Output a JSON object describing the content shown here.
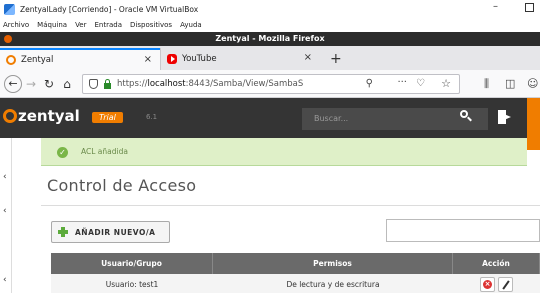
{
  "vbox": {
    "title": "ZentyalLady [Corriendo] - Oracle VM VirtualBox",
    "minimize": "–",
    "menu": [
      "Archivo",
      "Máquina",
      "Ver",
      "Entrada",
      "Dispositivos",
      "Ayuda"
    ]
  },
  "firefox": {
    "window_title": "Zentyal - Mozilla Firefox",
    "tabs": [
      {
        "label": "Zentyal",
        "close": "×"
      },
      {
        "label": "YouTube",
        "close": "×"
      }
    ],
    "new_tab": "+",
    "url_prefix": "https://",
    "url_host": "localhost",
    "url_rest": ":8443/Samba/View/SambaS",
    "more": "···"
  },
  "zentyal": {
    "logo_text": "zentyal",
    "edition": "Trial",
    "version": "6.1",
    "search_placeholder": "Buscar...",
    "note": "ACL añadida",
    "page_title": "Control de Acceso",
    "add_button": "AÑADIR NUEVO/A",
    "table": {
      "headers": [
        "Usuario/Grupo",
        "Permisos",
        "Acción"
      ],
      "rows": [
        {
          "user": "Usuario: test1",
          "permissions": "De lectura y de escritura"
        }
      ]
    },
    "left_arrows": [
      "‹",
      "‹",
      "‹"
    ]
  },
  "colors": {
    "brand_orange": "#f07d00",
    "header_bg": "#343434",
    "success_bg": "#dff0c8",
    "table_header": "#6a6a6a"
  }
}
